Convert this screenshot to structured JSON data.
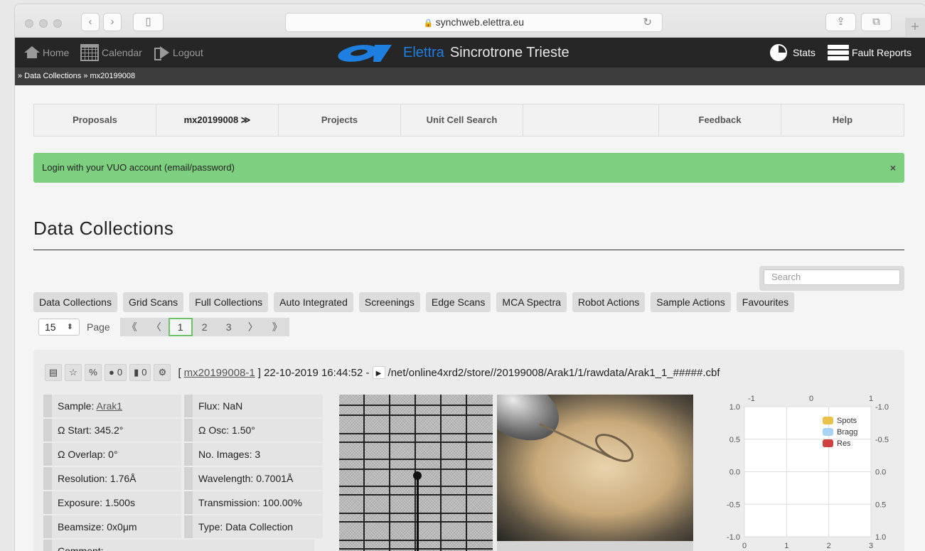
{
  "browser": {
    "url": "synchweb.elettra.eu"
  },
  "topnav": {
    "home": "Home",
    "calendar": "Calendar",
    "logout": "Logout",
    "brand_a": "Elettra",
    "brand_b": "Sincrotrone Trieste",
    "stats": "Stats",
    "fault_reports": "Fault Reports"
  },
  "breadcrumb": "» Data Collections » mx20199008",
  "menu": {
    "proposals": "Proposals",
    "proposal": "mx20199008 ≫",
    "projects": "Projects",
    "unit_cell": "Unit Cell Search",
    "feedback": "Feedback",
    "help": "Help"
  },
  "alert": {
    "text": "Login with your VUO account (email/password)",
    "close": "×"
  },
  "page_title": "Data Collections",
  "search": {
    "placeholder": "Search"
  },
  "tabs": [
    "Data Collections",
    "Grid Scans",
    "Full Collections",
    "Auto Integrated",
    "Screenings",
    "Edge Scans",
    "MCA Spectra",
    "Robot Actions",
    "Sample Actions",
    "Favourites"
  ],
  "pager": {
    "per_page": "15",
    "label": "Page",
    "first": "《",
    "prev": "〈",
    "pages": [
      "1",
      "2",
      "3"
    ],
    "next": "〉",
    "last": "》"
  },
  "collection": {
    "comments_count": "0",
    "attachments_count": "0",
    "link": "mx20199008-1",
    "datetime": "] 22-10-2019 16:44:52 -",
    "path": "/net/online4xrd2/store//20199008/Arak1/1/rawdata/Arak1_1_#####.cbf",
    "params": {
      "sample_label": "Sample: ",
      "sample": "Arak1",
      "flux": "Flux: NaN",
      "omega_start": "Ω Start: 345.2°",
      "omega_osc": "Ω Osc: 1.50°",
      "omega_overlap": "Ω Overlap: 0°",
      "num_images": "No. Images: 3",
      "resolution": "Resolution: 1.76Å",
      "wavelength": "Wavelength: 0.7001Å",
      "exposure": "Exposure: 1.500s",
      "transmission": "Transmission: 100.00%",
      "beamsize": "Beamsize: 0x0μm",
      "type": "Type: Data Collection",
      "comment": "Comment:"
    }
  },
  "chart_data": {
    "type": "line",
    "title": "",
    "x": [
      0,
      1,
      2,
      3
    ],
    "x_ticks_bottom": [
      "0",
      "1",
      "2",
      "3"
    ],
    "x_ticks_top": [
      "-1",
      "0",
      "1"
    ],
    "y_left_ticks": [
      "1.0",
      "0.5",
      "0.0",
      "-0.5",
      "-1.0"
    ],
    "y_right_ticks": [
      "-1.0",
      "-0.5",
      "0.0",
      "0.5",
      "1.0"
    ],
    "ylim": [
      -1,
      1
    ],
    "xlim": [
      0,
      3
    ],
    "series": [
      {
        "name": "Spots",
        "values": [],
        "color": "#e9c24a"
      },
      {
        "name": "Bragg",
        "values": [],
        "color": "#a9d3f2"
      },
      {
        "name": "Res",
        "values": [],
        "color": "#cf4040"
      }
    ],
    "legend": "top-right",
    "grid": true
  }
}
